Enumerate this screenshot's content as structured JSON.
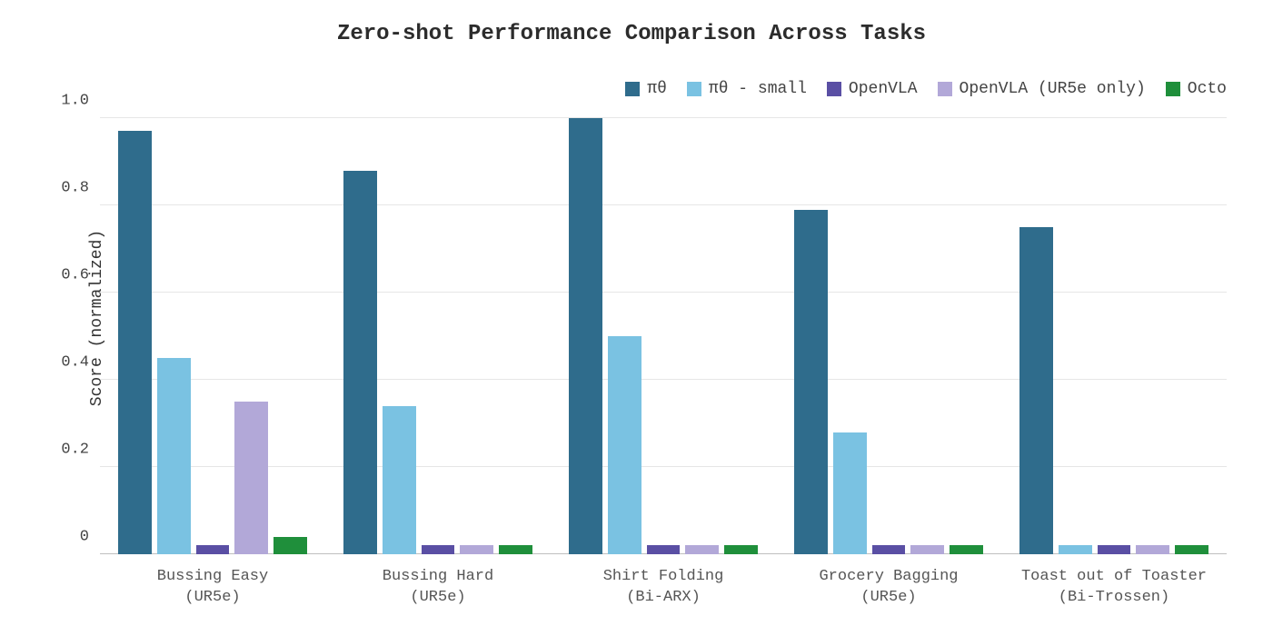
{
  "chart_data": {
    "type": "bar",
    "title": "Zero-shot Performance Comparison Across Tasks",
    "ylabel": "Score (normalized)",
    "xlabel": "",
    "ylim": [
      0,
      1.0
    ],
    "yticks": [
      0,
      0.2,
      0.4,
      0.6,
      0.8,
      1.0
    ],
    "ytick_labels": [
      "0",
      "0.2",
      "0.4",
      "0.6",
      "0.8",
      "1.0"
    ],
    "categories": [
      "Bussing Easy",
      "Bussing Hard",
      "Shirt Folding",
      "Grocery Bagging",
      "Toast out of Toaster"
    ],
    "category_sub": [
      "(UR5e)",
      "(UR5e)",
      "(Bi-ARX)",
      "(UR5e)",
      "(Bi-Trossen)"
    ],
    "series": [
      {
        "name": "πθ",
        "color": "#2f6c8c",
        "values": [
          0.97,
          0.88,
          1.0,
          0.79,
          0.75
        ]
      },
      {
        "name": "πθ - small",
        "color": "#7ac2e2",
        "values": [
          0.45,
          0.34,
          0.5,
          0.28,
          0.02
        ]
      },
      {
        "name": "OpenVLA",
        "color": "#5a4fa4",
        "values": [
          0.02,
          0.02,
          0.02,
          0.02,
          0.02
        ]
      },
      {
        "name": "OpenVLA (UR5e only)",
        "color": "#b2a8d8",
        "values": [
          0.35,
          0.02,
          0.02,
          0.02,
          0.02
        ]
      },
      {
        "name": "Octo",
        "color": "#1f8f3b",
        "values": [
          0.04,
          0.02,
          0.02,
          0.02,
          0.02
        ]
      }
    ],
    "legend_position": "top-right",
    "grid": true
  }
}
